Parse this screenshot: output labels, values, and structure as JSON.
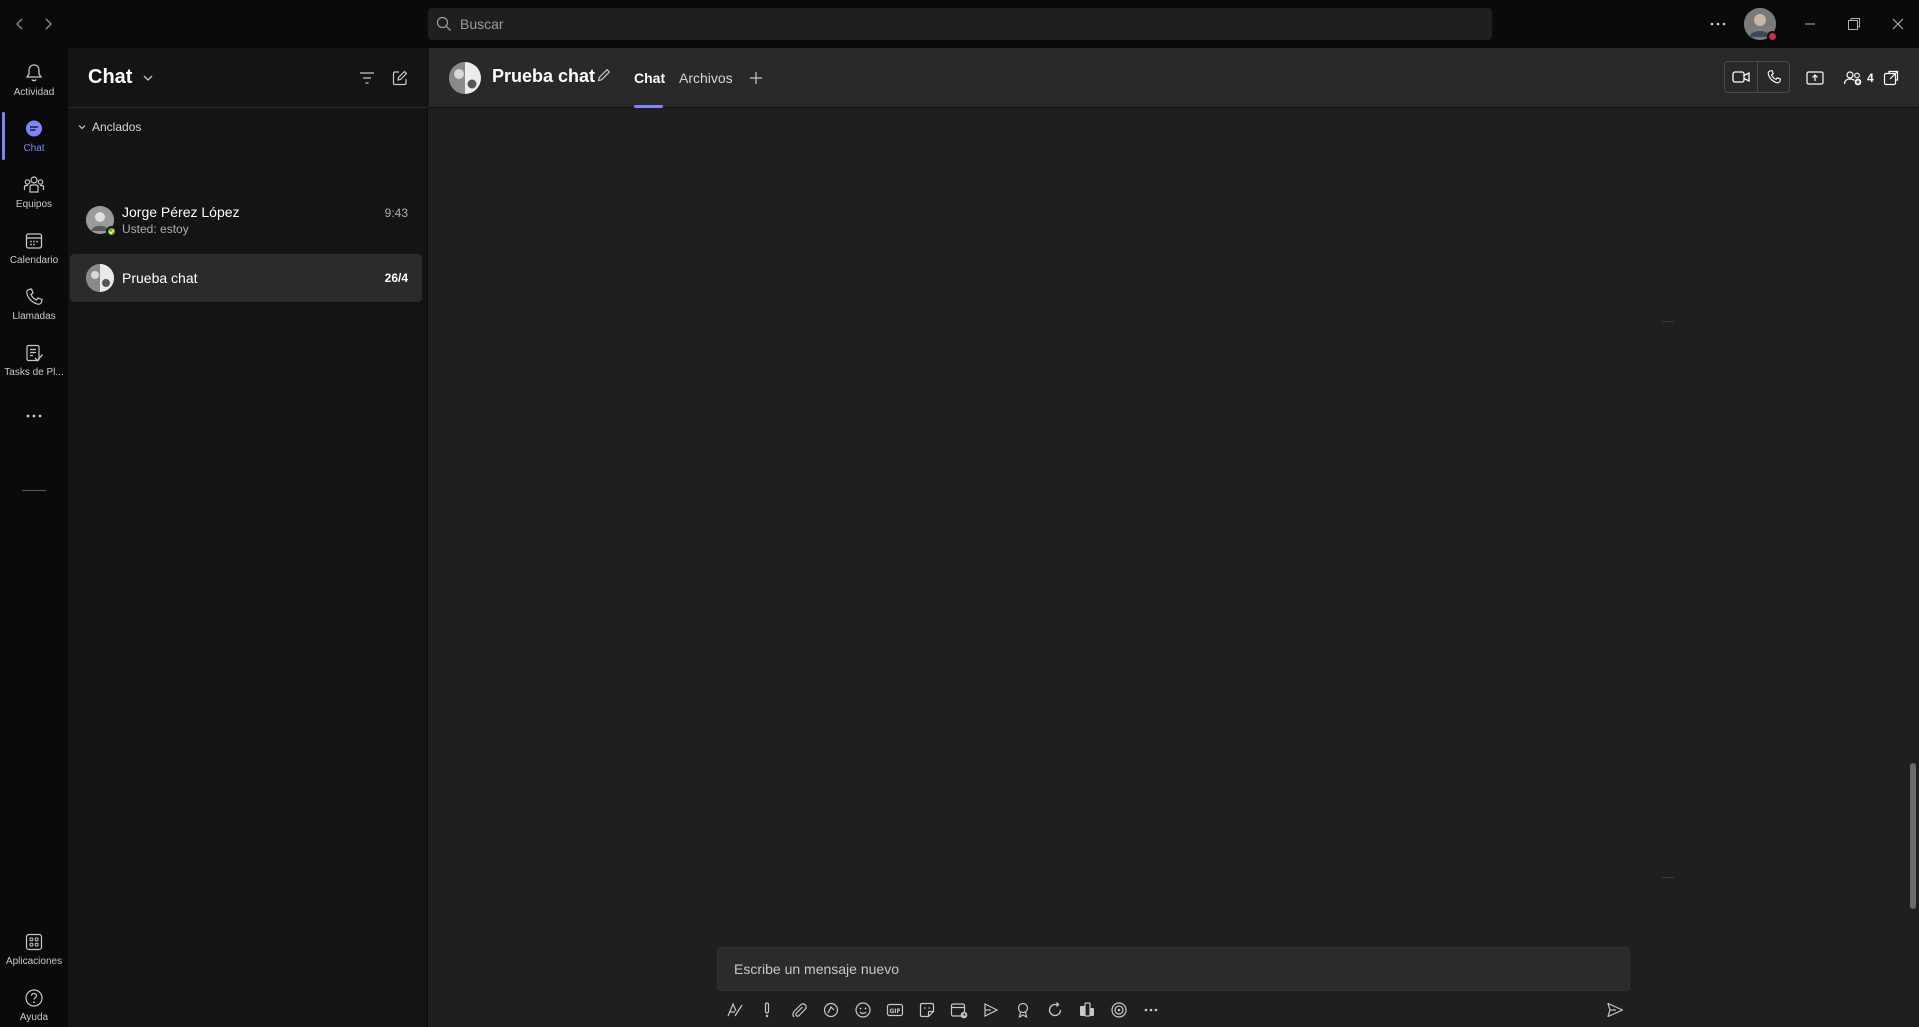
{
  "titlebar": {
    "search_placeholder": "Buscar"
  },
  "rail": {
    "items": [
      {
        "label": "Actividad",
        "icon": "bell-icon"
      },
      {
        "label": "Chat",
        "icon": "chat-icon",
        "active": true
      },
      {
        "label": "Equipos",
        "icon": "teams-icon"
      },
      {
        "label": "Calendario",
        "icon": "calendar-icon"
      },
      {
        "label": "Llamadas",
        "icon": "phone-icon"
      },
      {
        "label": "Tasks de Pl...",
        "icon": "tasks-icon"
      }
    ],
    "bottom": [
      {
        "label": "Aplicaciones",
        "icon": "apps-icon"
      },
      {
        "label": "Ayuda",
        "icon": "help-icon"
      }
    ]
  },
  "list": {
    "title": "Chat",
    "section_label": "Anclados",
    "chats": [
      {
        "name": "Jorge Pérez López",
        "preview": "Usted: estoy",
        "time": "9:43"
      },
      {
        "name": "Prueba chat",
        "preview": "",
        "time": "26/4"
      }
    ]
  },
  "conversation": {
    "title": "Prueba chat",
    "tabs": [
      "Chat",
      "Archivos"
    ],
    "participants_count": "4"
  },
  "composer": {
    "placeholder": "Escribe un mensaje nuevo"
  },
  "colors": {
    "accent": "#7f85f5",
    "presence_available": "#6bb700",
    "presence_busy": "#c4314b"
  }
}
